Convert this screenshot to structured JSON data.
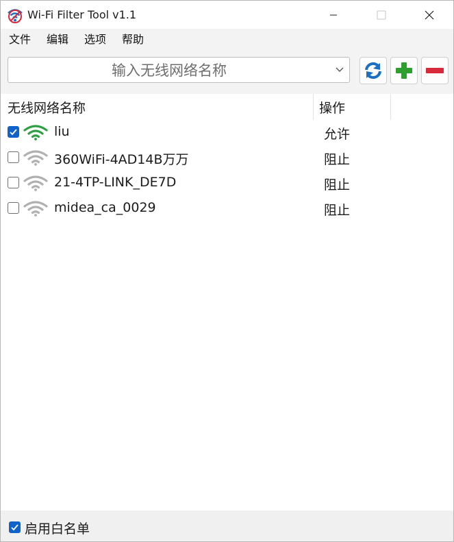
{
  "window": {
    "title": "Wi-Fi Filter Tool v1.1"
  },
  "menu": [
    "文件",
    "编辑",
    "选项",
    "帮助"
  ],
  "toolbar": {
    "ssid_placeholder": "输入无线网络名称",
    "refresh_icon": "refresh-icon",
    "add_icon": "plus-icon",
    "remove_icon": "minus-icon"
  },
  "list": {
    "columns": [
      "无线网络名称",
      "操作"
    ],
    "rows": [
      {
        "checked": true,
        "signal": "strong",
        "ssid": "liu",
        "action": "允许"
      },
      {
        "checked": false,
        "signal": "weak",
        "ssid": "360WiFi-4AD14B万万",
        "action": "阻止"
      },
      {
        "checked": false,
        "signal": "weak",
        "ssid": "21-4TP-LINK_DE7D",
        "action": "阻止"
      },
      {
        "checked": false,
        "signal": "weak",
        "ssid": "midea_ca_0029",
        "action": "阻止"
      }
    ]
  },
  "status": {
    "whitelist_checked": true,
    "whitelist_label": "启用白名单"
  },
  "colors": {
    "wifi_active": "#2ea043",
    "wifi_inactive": "#b0b0b0",
    "checkbox_on": "#0f62c9",
    "add": "#2e9e2e",
    "remove": "#d8293a",
    "refresh": "#1b6fc2"
  }
}
